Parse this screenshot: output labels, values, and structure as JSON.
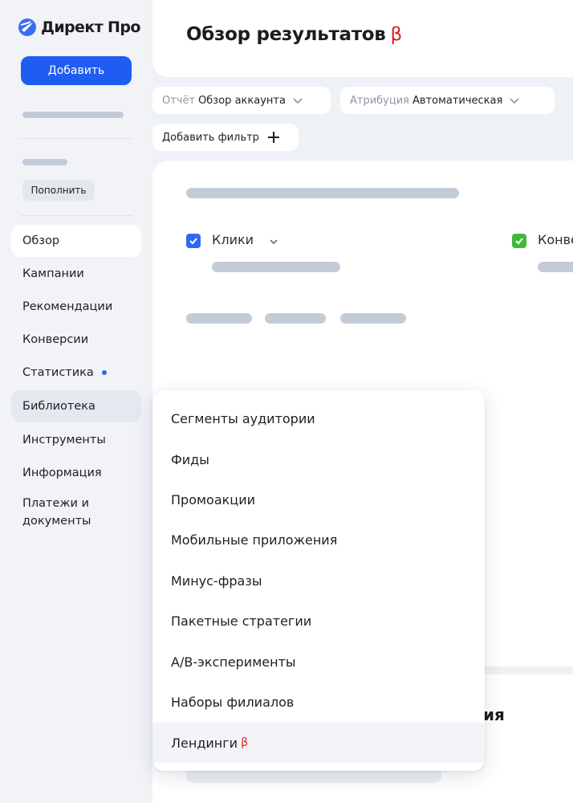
{
  "app": {
    "name": "Директ Про"
  },
  "sidebar": {
    "add_label": "Добавить",
    "refill_label": "Пополнить",
    "nav": [
      {
        "label": "Обзор"
      },
      {
        "label": "Кампании"
      },
      {
        "label": "Рекомендации"
      },
      {
        "label": "Конверсии"
      },
      {
        "label": "Статистика"
      },
      {
        "label": "Библиотека"
      },
      {
        "label": "Инструменты"
      },
      {
        "label": "Информация"
      },
      {
        "label": "Платежи и документы"
      }
    ]
  },
  "header": {
    "title": "Обзор результатов",
    "beta": "β"
  },
  "filters": {
    "report_key": "Отчёт",
    "report_value": "Обзор аккаунта",
    "attribution_key": "Атрибуция",
    "attribution_value": "Автоматическая",
    "add_filter_label": "Добавить фильтр"
  },
  "metrics": [
    {
      "label": "Клики",
      "checked": true,
      "color": "#2f68f5"
    },
    {
      "label": "Конве",
      "checked": true,
      "color": "#3fb83a"
    }
  ],
  "library_menu": {
    "items": [
      {
        "label": "Сегменты аудитории"
      },
      {
        "label": "Фиды"
      },
      {
        "label": "Промоакции"
      },
      {
        "label": "Мобильные приложения"
      },
      {
        "label": "Минус-фразы"
      },
      {
        "label": "Пакетные стратегии"
      },
      {
        "label": "A/B-эксперименты"
      },
      {
        "label": "Наборы филиалов"
      },
      {
        "label": "Лендинги",
        "beta": "β"
      }
    ]
  },
  "bottom_section": {
    "heading_fragment": "ия"
  },
  "colors": {
    "accent": "#1f5cf2",
    "beta": "#e1201c",
    "check_blue": "#2f68f5",
    "check_green": "#3fb83a"
  }
}
